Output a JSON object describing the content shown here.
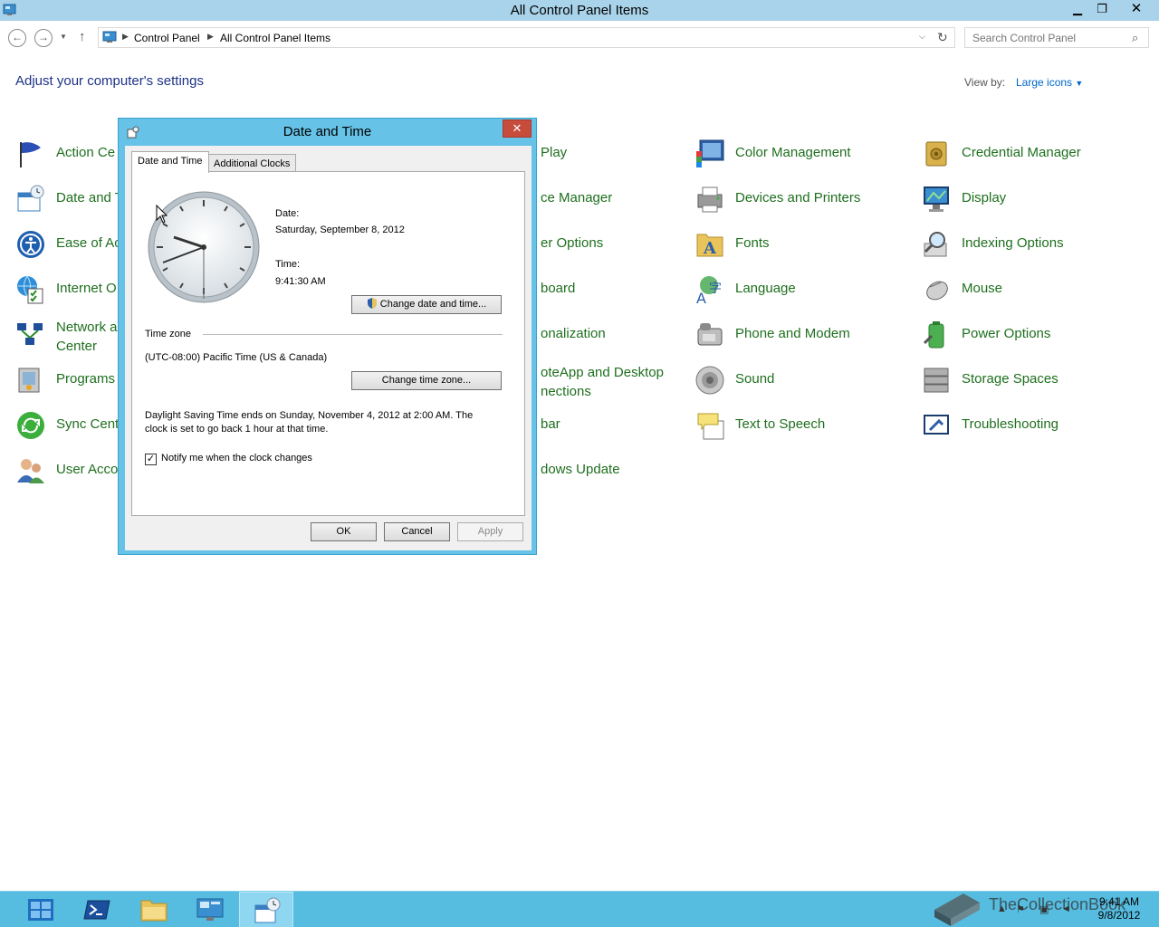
{
  "window": {
    "title": "All Control Panel Items"
  },
  "nav": {
    "breadcrumb": [
      "Control Panel",
      "All Control Panel Items"
    ],
    "search_placeholder": "Search Control Panel"
  },
  "header": {
    "title": "Adjust your computer's settings",
    "view_by_label": "View by:",
    "view_by_value": "Large icons"
  },
  "items": [
    {
      "label": "Action Ce",
      "icon": "action-center-flag-icon"
    },
    {
      "label": "Date and T",
      "icon": "calendar-icon"
    },
    {
      "label": "Ease of Ac",
      "icon": "ease-of-access-icon"
    },
    {
      "label": "Internet O",
      "icon": "internet-options-icon"
    },
    {
      "label_1": "Network a",
      "label_2": "Center",
      "icon": "network-icon"
    },
    {
      "label": "Programs",
      "icon": "programs-icon"
    },
    {
      "label": "Sync Cent",
      "icon": "sync-center-icon"
    },
    {
      "label": "User Acco",
      "icon": "user-accounts-icon"
    },
    {
      "label": "Play",
      "icon": "autoplay-icon"
    },
    {
      "label": "ce Manager",
      "icon": "device-manager-icon"
    },
    {
      "label": "er Options",
      "icon": "folder-options-icon"
    },
    {
      "label": "board",
      "icon": "keyboard-icon"
    },
    {
      "label": "onalization",
      "icon": "personalization-icon"
    },
    {
      "label_1": "oteApp and Desktop",
      "label_2": "nections",
      "icon": "remoteapp-icon"
    },
    {
      "label": "bar",
      "icon": "taskbar-icon"
    },
    {
      "label": "dows Update",
      "icon": "windows-update-icon"
    },
    {
      "label": "Color Management",
      "icon": "color-management-icon"
    },
    {
      "label": "Devices and Printers",
      "icon": "printer-icon"
    },
    {
      "label": "Fonts",
      "icon": "fonts-folder-icon"
    },
    {
      "label": "Language",
      "icon": "language-icon"
    },
    {
      "label": "Phone and Modem",
      "icon": "phone-icon"
    },
    {
      "label": "Sound",
      "icon": "speaker-icon"
    },
    {
      "label": "Text to Speech",
      "icon": "speech-bubble-icon"
    },
    {
      "label": "Credential Manager",
      "icon": "vault-icon"
    },
    {
      "label": "Display",
      "icon": "monitor-icon"
    },
    {
      "label": "Indexing Options",
      "icon": "magnifier-icon"
    },
    {
      "label": "Mouse",
      "icon": "mouse-icon"
    },
    {
      "label": "Power Options",
      "icon": "battery-icon"
    },
    {
      "label": "Storage Spaces",
      "icon": "storage-icon"
    },
    {
      "label": "Troubleshooting",
      "icon": "troubleshooting-icon"
    }
  ],
  "dialog": {
    "title": "Date and Time",
    "tabs": [
      "Date and Time",
      "Additional Clocks"
    ],
    "date_label": "Date:",
    "date_value": "Saturday, September 8, 2012",
    "time_label": "Time:",
    "time_value": "9:41:30 AM",
    "change_datetime_button": "Change date and time...",
    "timezone_heading": "Time zone",
    "timezone_value": "(UTC-08:00) Pacific Time (US & Canada)",
    "change_timezone_button": "Change time zone...",
    "dst_line_1": "Daylight Saving Time ends on Sunday, November 4, 2012 at 2:00 AM. The",
    "dst_line_2": "clock is set to go back 1 hour at that time.",
    "notify_label": "Notify me when the clock changes",
    "notify_checked": true,
    "ok": "OK",
    "cancel": "Cancel",
    "apply": "Apply"
  },
  "taskbar": {
    "buttons": [
      "server-manager",
      "powershell",
      "file-explorer",
      "control-panel",
      "date-and-time"
    ],
    "watermark": "TheCollectionBook",
    "clock_time": "9:41 AM",
    "clock_date": "9/8/2012"
  },
  "colors": {
    "titlebar": "#a9d3ea",
    "dialog_frame": "#66c2e6",
    "taskbar": "#56bde0",
    "link_green": "#1e6f1e",
    "header_blue": "#1e3287"
  }
}
